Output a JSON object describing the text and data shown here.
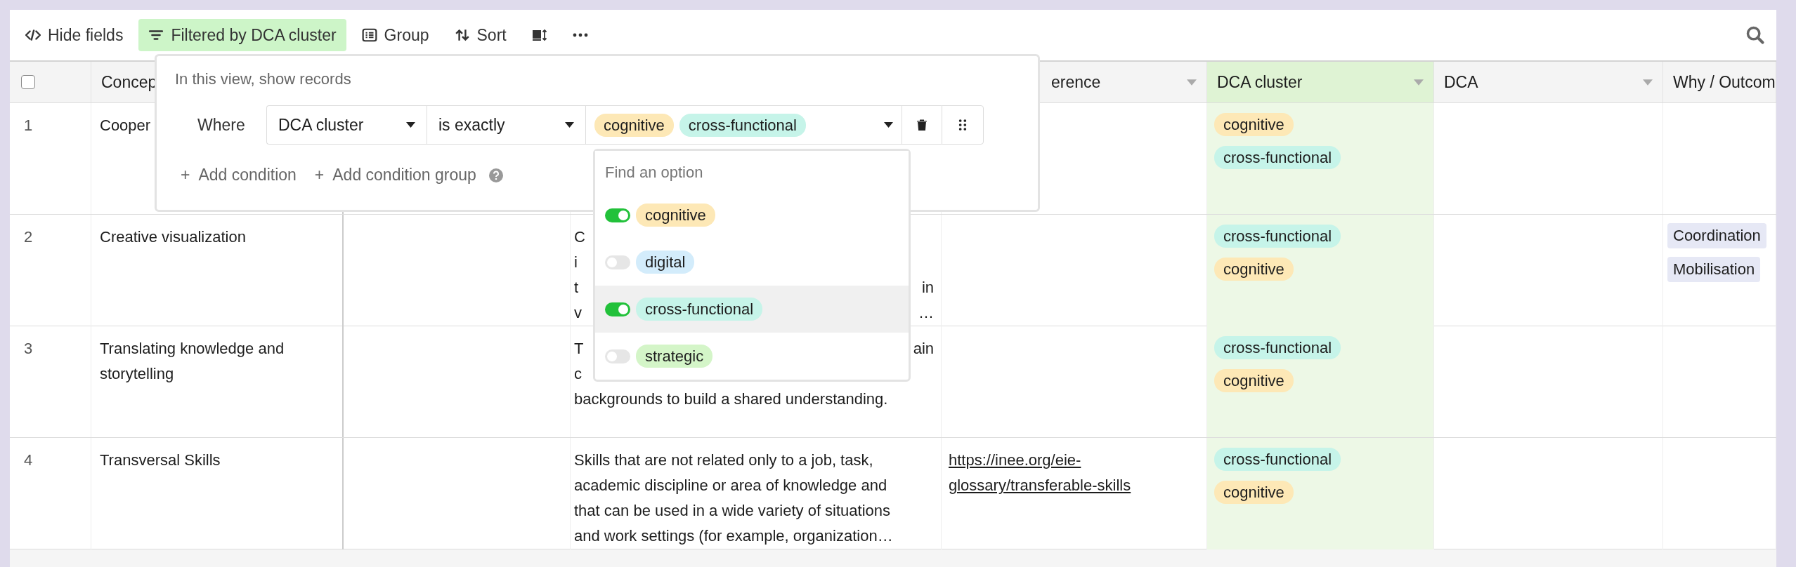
{
  "toolbar": {
    "buttons": [
      {
        "kind": "hide",
        "label": "Hide fields",
        "active": false
      },
      {
        "kind": "filter",
        "label": "Filtered by DCA cluster",
        "active": true
      },
      {
        "kind": "group",
        "label": "Group",
        "active": false
      },
      {
        "kind": "sort",
        "label": "Sort",
        "active": false
      },
      {
        "kind": "row-height",
        "active": false
      },
      {
        "kind": "more",
        "active": false
      }
    ]
  },
  "table": {
    "select_all": {
      "checked": false
    },
    "columns": [
      {
        "label": "Concep",
        "highlighted": false
      },
      {},
      {},
      {
        "label": "erence",
        "highlighted": false
      },
      {
        "label": "DCA cluster",
        "highlighted": true
      },
      {
        "label": "DCA",
        "highlighted": false
      },
      {
        "label": "Why / Outcom",
        "highlighted": false
      }
    ],
    "rows": [
      {
        "number": "1",
        "concept": "Cooper",
        "description": [],
        "dca_cluster": [
          {
            "label": "cognitive",
            "color": "#fde8b6"
          },
          {
            "label": "cross-functional",
            "color": "#c6f4e9"
          }
        ],
        "why": []
      },
      {
        "number": "2",
        "concept": "Creative visualization",
        "description": [
          {
            "start": "C"
          },
          {
            "start": "i"
          },
          {
            "start": "t",
            "end": "in"
          },
          {
            "start": "v",
            "end": "…"
          }
        ],
        "dca_cluster": [
          {
            "label": "cross-functional",
            "color": "#c6f4e9"
          },
          {
            "label": "cognitive",
            "color": "#fde8b6"
          }
        ],
        "why": [
          {
            "label": "Coordination"
          },
          {
            "label": "Mobilisation"
          }
        ]
      },
      {
        "number": "3",
        "concept": "Translating knowledge and storytelling",
        "description": [
          {
            "start": "T",
            "end": "ain"
          },
          {
            "start": "c"
          },
          {
            "start": "backgrounds to build a shared understanding."
          }
        ],
        "dca_cluster": [
          {
            "label": "cross-functional",
            "color": "#c6f4e9"
          },
          {
            "label": "cognitive",
            "color": "#fde8b6"
          }
        ],
        "why": []
      },
      {
        "number": "4",
        "concept": "Transversal Skills",
        "description": [
          {
            "start": "Skills that are not related only to a job, task,"
          },
          {
            "start": "academic discipline or area of knowledge and"
          },
          {
            "start": "that can be used in a wide variety of situations"
          },
          {
            "start": "and work settings (for example, organization…"
          }
        ],
        "reference": "https://inee.org/eie-glossary/transferable-skills",
        "dca_cluster": [
          {
            "label": "cross-functional",
            "color": "#c6f4e9"
          },
          {
            "label": "cognitive",
            "color": "#fde8b6"
          }
        ],
        "why": []
      }
    ]
  },
  "filter_popup": {
    "heading": "In this view, show records",
    "condition": {
      "where": "Where",
      "field": "DCA cluster",
      "operator": "is exactly",
      "values": [
        {
          "label": "cognitive",
          "color": "#fde8b6"
        },
        {
          "label": "cross-functional",
          "color": "#c6f4e9"
        }
      ]
    },
    "actions": [
      {
        "icon": "+",
        "label": "Add condition"
      },
      {
        "icon": "+",
        "label": "Add condition group"
      }
    ],
    "dropdown": {
      "placeholder": "Find an option",
      "options": [
        {
          "label": "cognitive",
          "color": "#fde8b6",
          "on": true,
          "highlighted": false
        },
        {
          "label": "digital",
          "color": "#d3ecfb",
          "on": false,
          "highlighted": false
        },
        {
          "label": "cross-functional",
          "color": "#c6f4e9",
          "on": true,
          "highlighted": true
        },
        {
          "label": "strategic",
          "color": "#d4f5c8",
          "on": false,
          "highlighted": false
        }
      ]
    }
  }
}
